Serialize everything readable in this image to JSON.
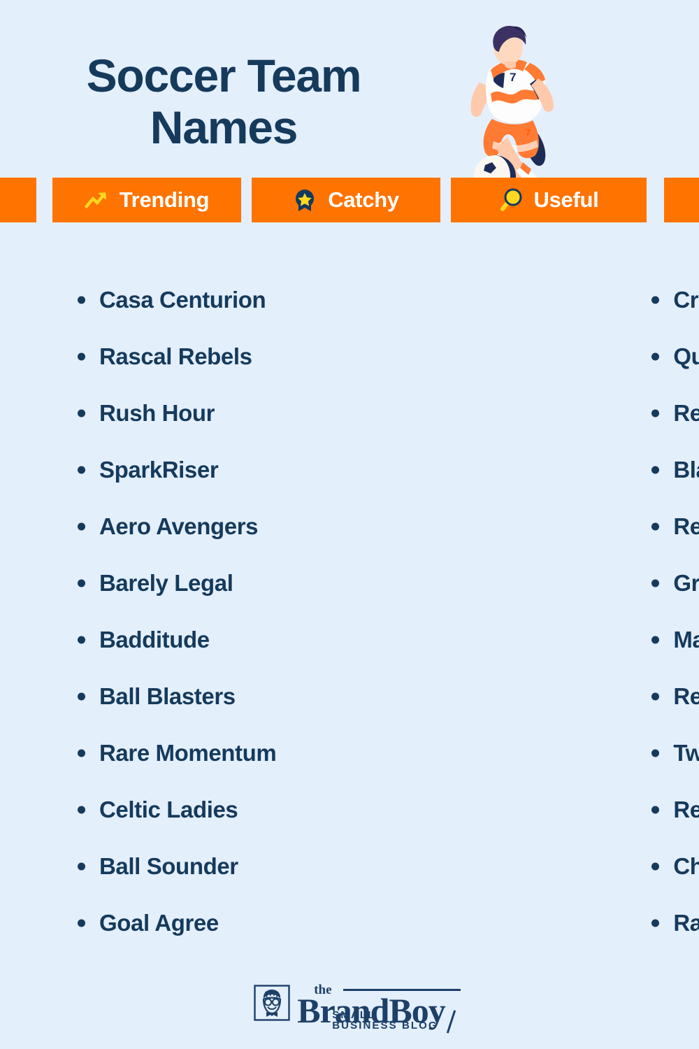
{
  "page": {
    "background_color": "#e4effc",
    "accent_color": "#ff7300",
    "text_color": "#153a5c",
    "highlight_color": "#ffd81f"
  },
  "header": {
    "title_line1": "Soccer Team",
    "title_line2": "Names",
    "illustration": "soccer-player-illustration",
    "jersey_number": "7"
  },
  "badges": [
    {
      "label": "Trending",
      "icon": "trending-up-icon"
    },
    {
      "label": "Catchy",
      "icon": "award-ribbon-star-icon"
    },
    {
      "label": "Useful",
      "icon": "magnifying-glass-icon"
    }
  ],
  "names": {
    "left_column": [
      "Casa Centurion",
      "Rascal Rebels",
      "Rush Hour",
      "SparkRiser",
      "Aero Avengers",
      "Barely Legal",
      "Badditude",
      "Ball Blasters",
      "Rare Momentum",
      "Celtic Ladies",
      "Ball Sounder",
      "Goal Agree"
    ],
    "right_column": [
      "Crapoli",
      "QuickSilver",
      "Red Devils",
      "Black Packers",
      "Red Dragons",
      "GreatGliders",
      "MadMatrix",
      "RedHippies",
      "Twister Rider",
      "Real Sosobad",
      "Chili Peppers",
      "Rage punisher"
    ]
  },
  "footer": {
    "logo_the": "the",
    "logo_brand": "BrandBoy",
    "logo_tagline": "SMALL BUSINESS BLOG",
    "logo_mark": "boy-face-logo-icon"
  }
}
